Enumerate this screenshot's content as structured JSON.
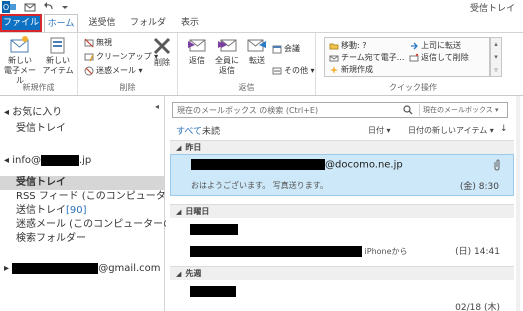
{
  "titlebar": {
    "title": "受信トレイ"
  },
  "tabs": [
    {
      "label": "ファイル"
    },
    {
      "label": "ホーム"
    },
    {
      "label": "送受信"
    },
    {
      "label": "フォルダー"
    },
    {
      "label": "表示"
    }
  ],
  "ribbon": {
    "new_group": {
      "label": "新規作成",
      "new_mail": "新しい\n電子メール",
      "new_items": "新しい\nアイテム"
    },
    "delete_group": {
      "label": "削除",
      "ignore": "無視",
      "cleanup": "クリーンアップ",
      "junk": "迷惑メール",
      "delete": "削除"
    },
    "respond_group": {
      "label": "返信",
      "reply": "返信",
      "reply_all": "全員に\n返信",
      "forward": "転送",
      "meeting": "会議",
      "more": "その他"
    },
    "quick_steps": {
      "label": "クイック操作",
      "move": "移動: ?",
      "team": "チーム宛て電子...",
      "new": "新規作成",
      "to_manager": "上司に転送",
      "reply_delete": "返信して削除"
    }
  },
  "folders": {
    "favorites_header": "お気に入り",
    "favorites_inbox": "受信トレイ",
    "account1_prefix": "info@",
    "account1_suffix": ".jp",
    "inbox": "受信トレイ",
    "rss": "RSS フィード (このコンピューターのみ)",
    "sent": "送信トレイ",
    "sent_count": "[90]",
    "junk": "迷惑メール (このコンピューターのみ)",
    "search": "検索フォルダー",
    "account2_suffix": "@gmail.com"
  },
  "search": {
    "placeholder": "現在のメールボックス の検索 (Ctrl+E)",
    "scope": "現在のメールボックス"
  },
  "filter": {
    "all": "すべて",
    "unread": "未読",
    "sort_by": "日付",
    "sort_order": "日付の新しいアイテム",
    "arrow": "↓"
  },
  "messages": {
    "group_yesterday": "昨日",
    "msg1_sender_suffix": "@docomo.ne.jp",
    "msg1_preview": "おはようございます。 写真送ります。",
    "msg1_date": "(金) 8:30",
    "group_sunday": "日曜日",
    "msg2_preview": "iPhoneから",
    "msg2_date": "(日) 14:41",
    "group_lastweek": "先週",
    "msg3_date": "02/18 (木)"
  },
  "colors": {
    "file_tab": "#0e72c4",
    "file_tab_border": "#d9262b",
    "selected_message": "#cde8f8",
    "accent": "#2a72b8"
  }
}
